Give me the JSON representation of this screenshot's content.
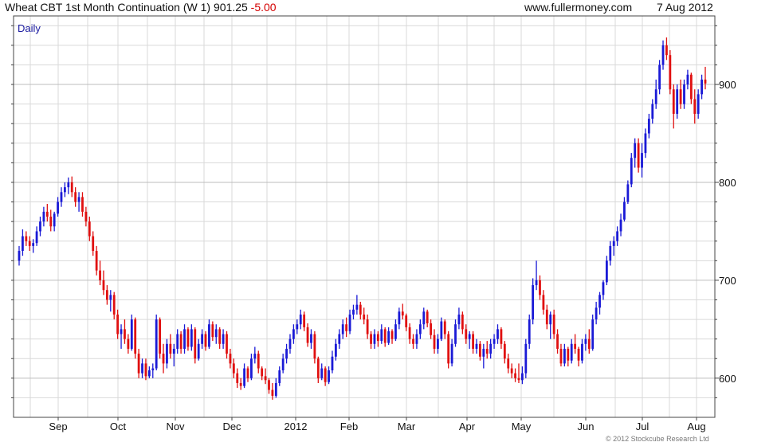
{
  "header": {
    "title": "Wheat CBT 1st Month Continuation (W 1) 901.25",
    "change": "-5.00",
    "site": "www.fullermoney.com",
    "date": "7 Aug 2012"
  },
  "chart": {
    "period_label": "Daily",
    "copyright": "© 2012 Stockcube Research Ltd"
  },
  "colors": {
    "up": "#1a1ad6",
    "down": "#e01010",
    "grid": "#d9d9d9",
    "axis": "#444444"
  },
  "chart_data": {
    "type": "ohlc",
    "x_tick_labels": [
      "Sep",
      "Oct",
      "Nov",
      "Dec",
      "2012",
      "Feb",
      "Mar",
      "Apr",
      "May",
      "Jun",
      "Jul",
      "Aug"
    ],
    "y_tick_labels": [
      "600",
      "700",
      "800",
      "900"
    ],
    "ylim": [
      560,
      970
    ],
    "grid": true,
    "series": [
      {
        "values": [
          [
            720,
            735,
            715,
            730
          ],
          [
            730,
            752,
            725,
            745
          ],
          [
            745,
            750,
            735,
            740
          ],
          [
            740,
            745,
            730,
            735
          ],
          [
            735,
            742,
            728,
            738
          ],
          [
            738,
            755,
            735,
            750
          ],
          [
            750,
            765,
            745,
            760
          ],
          [
            760,
            775,
            755,
            770
          ],
          [
            770,
            778,
            760,
            765
          ],
          [
            765,
            772,
            750,
            755
          ],
          [
            755,
            770,
            750,
            768
          ],
          [
            768,
            785,
            765,
            780
          ],
          [
            780,
            795,
            775,
            790
          ],
          [
            790,
            800,
            785,
            795
          ],
          [
            795,
            805,
            788,
            800
          ],
          [
            800,
            806,
            785,
            790
          ],
          [
            790,
            795,
            775,
            780
          ],
          [
            780,
            790,
            770,
            785
          ],
          [
            785,
            790,
            765,
            770
          ],
          [
            770,
            775,
            755,
            760
          ],
          [
            760,
            765,
            740,
            745
          ],
          [
            745,
            750,
            725,
            730
          ],
          [
            730,
            735,
            705,
            710
          ],
          [
            710,
            720,
            695,
            700
          ],
          [
            700,
            710,
            685,
            690
          ],
          [
            690,
            695,
            675,
            680
          ],
          [
            680,
            690,
            668,
            685
          ],
          [
            685,
            688,
            660,
            665
          ],
          [
            665,
            670,
            640,
            645
          ],
          [
            645,
            655,
            630,
            650
          ],
          [
            650,
            660,
            635,
            640
          ],
          [
            640,
            645,
            625,
            630
          ],
          [
            630,
            665,
            628,
            660
          ],
          [
            660,
            662,
            620,
            625
          ],
          [
            625,
            630,
            600,
            605
          ],
          [
            605,
            620,
            600,
            615
          ],
          [
            615,
            620,
            598,
            602
          ],
          [
            602,
            612,
            600,
            608
          ],
          [
            608,
            615,
            600,
            610
          ],
          [
            610,
            665,
            608,
            660
          ],
          [
            660,
            662,
            620,
            625
          ],
          [
            625,
            635,
            605,
            615
          ],
          [
            615,
            640,
            610,
            635
          ],
          [
            635,
            645,
            620,
            625
          ],
          [
            625,
            635,
            612,
            630
          ],
          [
            630,
            650,
            625,
            645
          ],
          [
            645,
            648,
            625,
            630
          ],
          [
            630,
            655,
            625,
            650
          ],
          [
            650,
            652,
            628,
            632
          ],
          [
            632,
            655,
            628,
            650
          ],
          [
            650,
            652,
            615,
            620
          ],
          [
            620,
            640,
            618,
            635
          ],
          [
            635,
            650,
            630,
            645
          ],
          [
            645,
            648,
            628,
            632
          ],
          [
            632,
            660,
            630,
            655
          ],
          [
            655,
            658,
            638,
            642
          ],
          [
            642,
            655,
            635,
            650
          ],
          [
            650,
            652,
            630,
            635
          ],
          [
            635,
            650,
            630,
            645
          ],
          [
            645,
            648,
            620,
            625
          ],
          [
            625,
            630,
            610,
            615
          ],
          [
            615,
            620,
            600,
            605
          ],
          [
            605,
            610,
            590,
            595
          ],
          [
            595,
            600,
            588,
            592
          ],
          [
            592,
            615,
            590,
            610
          ],
          [
            610,
            612,
            596,
            600
          ],
          [
            600,
            625,
            598,
            620
          ],
          [
            620,
            632,
            615,
            625
          ],
          [
            625,
            628,
            605,
            610
          ],
          [
            610,
            612,
            598,
            602
          ],
          [
            602,
            610,
            594,
            598
          ],
          [
            598,
            600,
            584,
            588
          ],
          [
            588,
            595,
            578,
            582
          ],
          [
            582,
            600,
            580,
            595
          ],
          [
            595,
            612,
            592,
            608
          ],
          [
            608,
            625,
            605,
            620
          ],
          [
            620,
            635,
            615,
            630
          ],
          [
            630,
            645,
            625,
            640
          ],
          [
            640,
            655,
            635,
            650
          ],
          [
            650,
            660,
            645,
            655
          ],
          [
            655,
            670,
            650,
            665
          ],
          [
            665,
            668,
            648,
            652
          ],
          [
            652,
            656,
            632,
            636
          ],
          [
            636,
            650,
            630,
            645
          ],
          [
            645,
            648,
            615,
            620
          ],
          [
            620,
            622,
            595,
            600
          ],
          [
            600,
            615,
            598,
            610
          ],
          [
            610,
            612,
            592,
            596
          ],
          [
            596,
            612,
            594,
            608
          ],
          [
            608,
            628,
            605,
            622
          ],
          [
            622,
            640,
            618,
            635
          ],
          [
            635,
            650,
            630,
            645
          ],
          [
            645,
            660,
            640,
            655
          ],
          [
            655,
            662,
            642,
            648
          ],
          [
            648,
            670,
            645,
            665
          ],
          [
            665,
            675,
            660,
            670
          ],
          [
            670,
            685,
            665,
            675
          ],
          [
            675,
            678,
            660,
            665
          ],
          [
            665,
            672,
            655,
            660
          ],
          [
            660,
            665,
            640,
            645
          ],
          [
            645,
            648,
            630,
            635
          ],
          [
            635,
            650,
            630,
            645
          ],
          [
            645,
            648,
            632,
            638
          ],
          [
            638,
            655,
            635,
            650
          ],
          [
            650,
            652,
            632,
            636
          ],
          [
            636,
            652,
            634,
            648
          ],
          [
            648,
            650,
            635,
            640
          ],
          [
            640,
            660,
            638,
            655
          ],
          [
            655,
            672,
            650,
            668
          ],
          [
            668,
            676,
            660,
            664
          ],
          [
            664,
            666,
            648,
            652
          ],
          [
            652,
            656,
            635,
            640
          ],
          [
            640,
            645,
            630,
            635
          ],
          [
            635,
            650,
            630,
            645
          ],
          [
            645,
            660,
            640,
            655
          ],
          [
            655,
            672,
            650,
            668
          ],
          [
            668,
            670,
            652,
            656
          ],
          [
            656,
            660,
            640,
            644
          ],
          [
            644,
            650,
            625,
            630
          ],
          [
            630,
            645,
            625,
            640
          ],
          [
            640,
            662,
            638,
            658
          ],
          [
            658,
            660,
            640,
            645
          ],
          [
            645,
            648,
            610,
            615
          ],
          [
            615,
            640,
            612,
            635
          ],
          [
            635,
            660,
            632,
            655
          ],
          [
            655,
            672,
            650,
            665
          ],
          [
            665,
            668,
            645,
            650
          ],
          [
            650,
            655,
            635,
            640
          ],
          [
            640,
            648,
            630,
            645
          ],
          [
            645,
            648,
            625,
            630
          ],
          [
            630,
            640,
            625,
            635
          ],
          [
            635,
            638,
            618,
            622
          ],
          [
            622,
            635,
            610,
            630
          ],
          [
            630,
            638,
            620,
            625
          ],
          [
            625,
            640,
            620,
            635
          ],
          [
            635,
            645,
            630,
            640
          ],
          [
            640,
            655,
            635,
            650
          ],
          [
            650,
            652,
            630,
            635
          ],
          [
            635,
            638,
            615,
            620
          ],
          [
            620,
            625,
            605,
            610
          ],
          [
            610,
            615,
            600,
            605
          ],
          [
            605,
            610,
            596,
            600
          ],
          [
            600,
            615,
            595,
            598
          ],
          [
            598,
            612,
            594,
            605
          ],
          [
            605,
            640,
            600,
            635
          ],
          [
            635,
            665,
            630,
            660
          ],
          [
            660,
            702,
            655,
            695
          ],
          [
            695,
            720,
            690,
            700
          ],
          [
            700,
            705,
            680,
            685
          ],
          [
            685,
            690,
            665,
            670
          ],
          [
            670,
            675,
            650,
            655
          ],
          [
            655,
            668,
            640,
            665
          ],
          [
            665,
            670,
            640,
            645
          ],
          [
            645,
            650,
            625,
            630
          ],
          [
            630,
            635,
            612,
            615
          ],
          [
            615,
            635,
            612,
            630
          ],
          [
            630,
            632,
            612,
            618
          ],
          [
            618,
            640,
            615,
            635
          ],
          [
            635,
            645,
            625,
            630
          ],
          [
            630,
            632,
            612,
            618
          ],
          [
            618,
            640,
            615,
            635
          ],
          [
            635,
            645,
            628,
            640
          ],
          [
            640,
            650,
            625,
            630
          ],
          [
            630,
            665,
            628,
            660
          ],
          [
            660,
            678,
            655,
            672
          ],
          [
            672,
            688,
            665,
            685
          ],
          [
            685,
            700,
            680,
            698
          ],
          [
            698,
            725,
            695,
            720
          ],
          [
            720,
            740,
            715,
            735
          ],
          [
            735,
            745,
            725,
            740
          ],
          [
            740,
            755,
            735,
            750
          ],
          [
            750,
            768,
            745,
            762
          ],
          [
            762,
            785,
            760,
            780
          ],
          [
            780,
            802,
            778,
            798
          ],
          [
            798,
            830,
            795,
            825
          ],
          [
            825,
            845,
            815,
            840
          ],
          [
            840,
            845,
            810,
            815
          ],
          [
            815,
            840,
            805,
            830
          ],
          [
            830,
            855,
            825,
            850
          ],
          [
            850,
            870,
            845,
            865
          ],
          [
            865,
            885,
            860,
            880
          ],
          [
            880,
            905,
            875,
            895
          ],
          [
            895,
            925,
            890,
            920
          ],
          [
            920,
            945,
            915,
            940
          ],
          [
            940,
            948,
            925,
            930
          ],
          [
            930,
            935,
            890,
            895
          ],
          [
            895,
            900,
            855,
            870
          ],
          [
            870,
            900,
            865,
            895
          ],
          [
            895,
            905,
            875,
            880
          ],
          [
            880,
            905,
            875,
            900
          ],
          [
            900,
            915,
            895,
            910
          ],
          [
            910,
            912,
            880,
            885
          ],
          [
            885,
            895,
            860,
            870
          ],
          [
            870,
            895,
            865,
            890
          ],
          [
            890,
            910,
            885,
            905
          ],
          [
            905,
            918,
            895,
            901
          ]
        ]
      }
    ]
  }
}
